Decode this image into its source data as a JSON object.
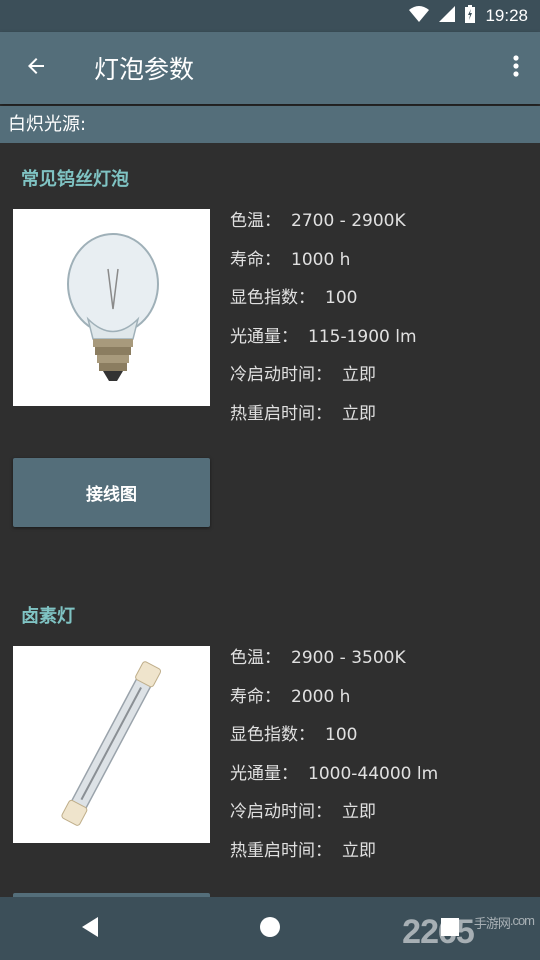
{
  "status_bar": {
    "time": "19:28"
  },
  "app_bar": {
    "title": "灯泡参数"
  },
  "section": {
    "title": "白炽光源:"
  },
  "products": [
    {
      "name": "常见钨丝灯泡",
      "specs": [
        {
          "label": "色温：",
          "value": "2700 - 2900K"
        },
        {
          "label": "寿命：",
          "value": "1000 h"
        },
        {
          "label": "显色指数：",
          "value": "100"
        },
        {
          "label": "光通量：",
          "value": "115-1900 lm"
        },
        {
          "label": "冷启动时间：",
          "value": "立即"
        },
        {
          "label": "热重启时间：",
          "value": "立即"
        }
      ],
      "button_label": "接线图"
    },
    {
      "name": "卤素灯",
      "specs": [
        {
          "label": "色温：",
          "value": "2900 - 3500K"
        },
        {
          "label": "寿命：",
          "value": "2000 h"
        },
        {
          "label": "显色指数：",
          "value": "100"
        },
        {
          "label": "光通量：",
          "value": "1000-44000 lm"
        },
        {
          "label": "冷启动时间：",
          "value": "立即"
        },
        {
          "label": "热重启时间：",
          "value": "立即"
        }
      ]
    }
  ],
  "watermark": {
    "brand": "2265",
    "site": "手游网",
    "domain": ".com"
  },
  "colors": {
    "app_bar": "#546e7a",
    "status_bar": "#3c4f59",
    "background": "#2f2f2f",
    "accent_title": "#7fc3c3"
  },
  "icons": {
    "back": "arrow-left-icon",
    "menu": "more-vert-icon",
    "nav_back": "triangle-back-icon",
    "nav_home": "circle-home-icon",
    "nav_recents": "square-recents-icon"
  }
}
